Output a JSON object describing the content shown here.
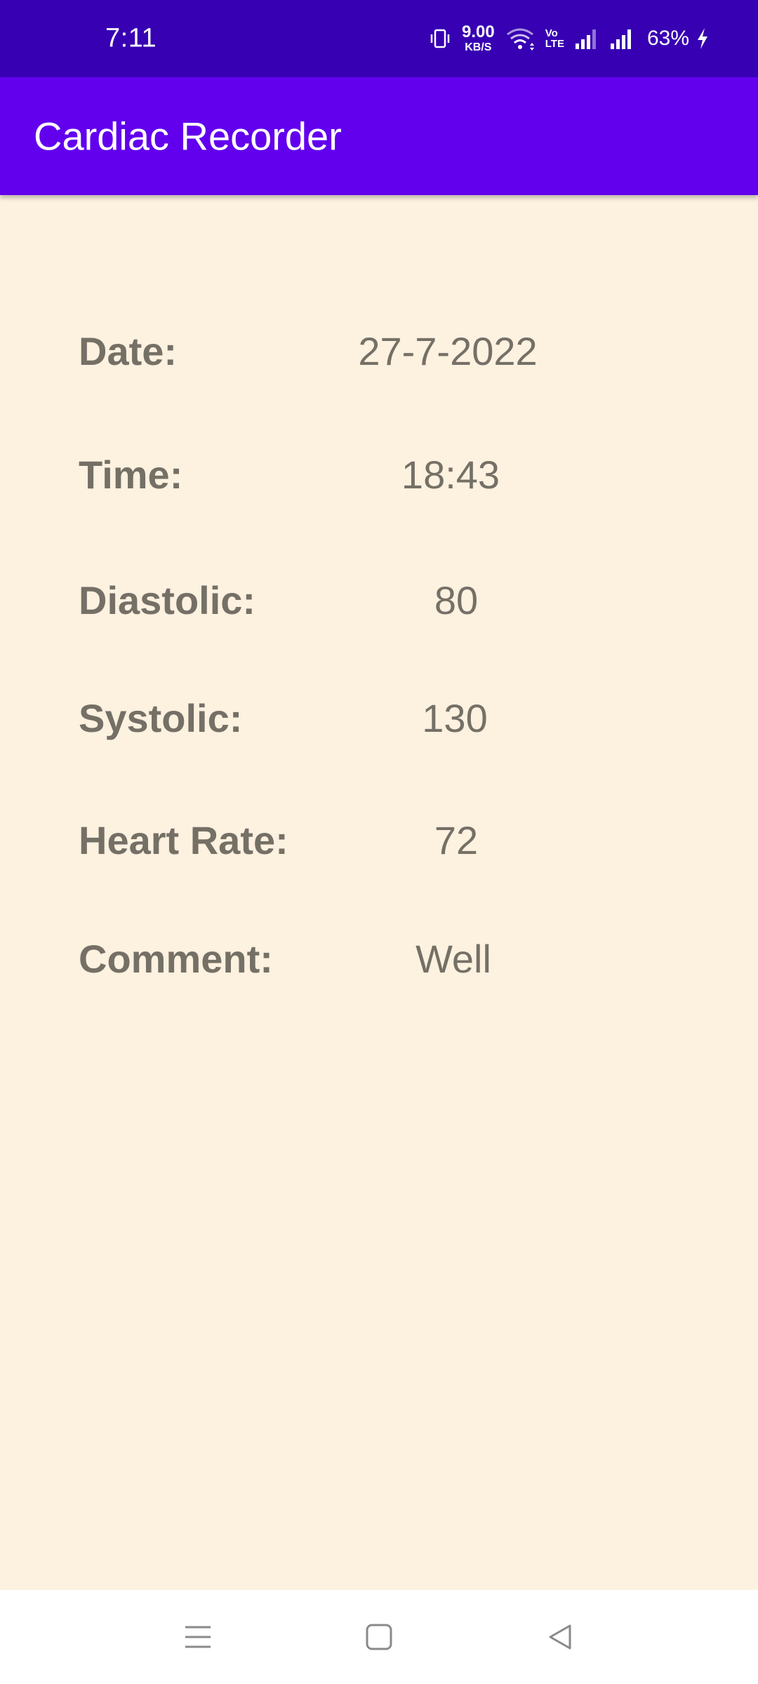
{
  "status_bar": {
    "time": "7:11",
    "net_speed_value": "9.00",
    "net_speed_unit": "KB/S",
    "volte_top": "Vo",
    "volte_bottom": "LTE",
    "battery_percent": "63%",
    "icons": [
      "vibrate-icon",
      "wifi-icon",
      "volte-icon",
      "signal-icon",
      "signal-icon",
      "charging-icon"
    ]
  },
  "app_bar": {
    "title": "Cardiac Recorder",
    "color": "#6200ee",
    "status_color": "#3700b3"
  },
  "record": {
    "date_label": "Date:",
    "date_value": "27-7-2022",
    "time_label": "Time:",
    "time_value": "18:43",
    "diastolic_label": "Diastolic:",
    "diastolic_value": "80",
    "systolic_label": "Systolic:",
    "systolic_value": "130",
    "heart_rate_label": "Heart Rate:",
    "heart_rate_value": "72",
    "comment_label": "Comment:",
    "comment_value": "Well"
  },
  "nav_bar": {
    "icons": [
      "menu-icon",
      "home-icon",
      "back-icon"
    ]
  }
}
